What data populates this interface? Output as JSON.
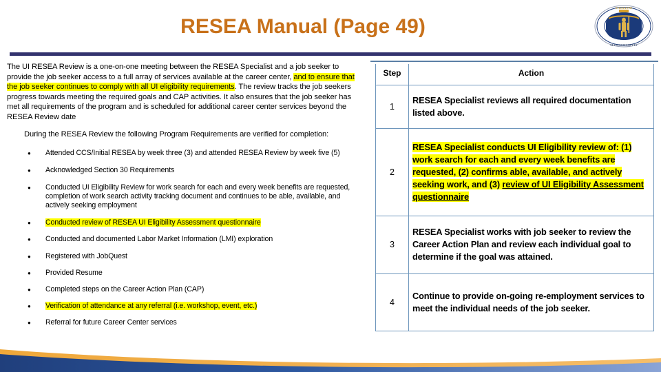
{
  "header": {
    "title": "RESEA Manual (Page 49)",
    "seal_name": "massachusetts-state-seal",
    "title_color": "#C8711A",
    "divider_color": "#33336E"
  },
  "left": {
    "intro": {
      "part1": "The UI RESEA Review is a one-on-one meeting between the RESEA Specialist and a job seeker to provide the job seeker access to a full array of services available at the career center, ",
      "highlight": "and to ensure that the job seeker continues to comply with all UI eligibility requirements",
      "part2": ". The review tracks the job seekers progress towards meeting the required goals and CAP activities. It also ensures that the job seeker has met all requirements of the program and is scheduled for additional career center services beyond the RESEA Review date"
    },
    "requirements_intro": "During the RESEA Review the following Program Requirements are verified for completion:",
    "bullets": [
      {
        "text": "Attended CCS/Initial RESEA by week three (3) and attended RESEA Review by week five (5)",
        "highlighted": false
      },
      {
        "text": "Acknowledged Section 30 Requirements",
        "highlighted": false
      },
      {
        "text": "Conducted UI Eligibility Review for work search for each and every week benefits are requested, completion of work search activity tracking document and continues to be able, available, and actively seeking employment",
        "highlighted": false
      },
      {
        "text": "Conducted review of RESEA UI Eligibility Assessment questionnaire",
        "highlighted": true
      },
      {
        "text": "Conducted and documented Labor Market Information (LMI) exploration",
        "highlighted": false
      },
      {
        "text": "Registered with JobQuest",
        "highlighted": false
      },
      {
        "text": "Provided Resume",
        "highlighted": false
      },
      {
        "text": "Completed steps on the Career Action Plan (CAP)",
        "highlighted": false
      },
      {
        "text": "Verification of attendance at any referral (i.e. workshop, event, etc.)",
        "highlighted": true
      },
      {
        "text": "Referral for future Career Center services",
        "highlighted": false
      }
    ],
    "highlight_color": "#FFFF00"
  },
  "table": {
    "headers": {
      "step": "Step",
      "action": "Action"
    },
    "border_color": "#6E96BC",
    "rows": [
      {
        "step": "1",
        "action": "RESEA Specialist reviews all required documentation listed above.",
        "highlighted": false
      },
      {
        "step": "2",
        "action_plain": "RESEA Specialist conducts UI Eligibility review of: (1) work search for each and every week benefits are requested, (2) confirms able, available, and actively seeking work, and (3) ",
        "action_underlined": "review of UI Eligibility Assessment questionnaire",
        "highlighted": true
      },
      {
        "step": "3",
        "action": "RESEA Specialist works with job seeker to review the Career Action Plan and review each individual goal to determine if the goal was attained.",
        "highlighted": false
      },
      {
        "step": "4",
        "action": "Continue to provide on-going re-employment services to meet the individual needs of the job seeker.",
        "highlighted": false
      }
    ]
  },
  "footer": {
    "swoosh_name": "decorative-swoosh",
    "orange": "#F0A93C",
    "blue_dark": "#2A4F8F",
    "blue_light": "#7D9BD0"
  }
}
